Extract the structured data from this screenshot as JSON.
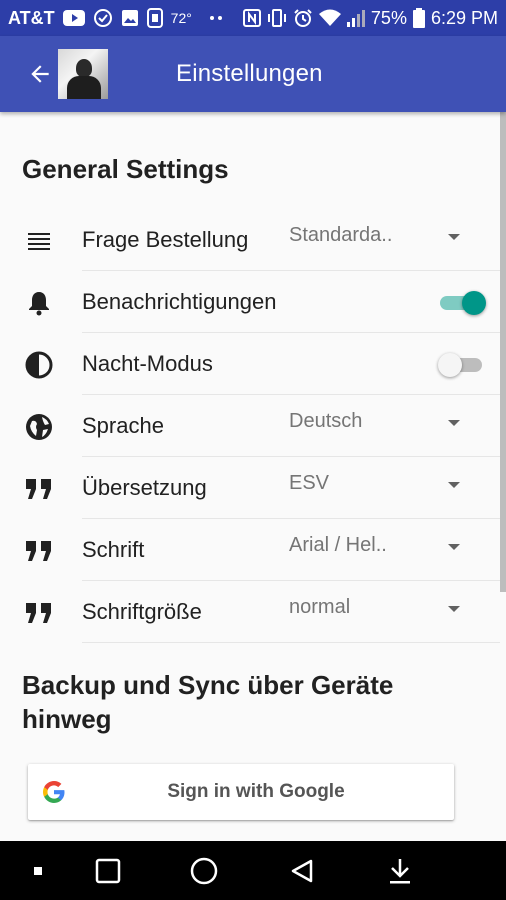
{
  "status_bar": {
    "carrier": "AT&T",
    "temperature": "72°",
    "battery_percent": "75%",
    "time": "6:29 PM",
    "icons_left": [
      "youtube-icon",
      "check-circle-icon",
      "image-icon",
      "app-icon",
      "weather-icon",
      "more-dots-icon"
    ],
    "icons_right": [
      "nfc-icon",
      "vibrate-icon",
      "alarm-icon",
      "wifi-icon",
      "signal-icon",
      "battery-icon"
    ]
  },
  "app_bar": {
    "title": "Einstellungen",
    "back_icon": "arrow-back-icon",
    "avatar": "profile-picture"
  },
  "general": {
    "title": "General Settings",
    "items": [
      {
        "icon": "list-icon",
        "label": "Frage Bestellung",
        "type": "dropdown",
        "value": "Standarda.."
      },
      {
        "icon": "bell-icon",
        "label": "Benachrichtigungen",
        "type": "toggle",
        "checked": true
      },
      {
        "icon": "contrast-icon",
        "label": "Nacht-Modus",
        "type": "toggle",
        "checked": false
      },
      {
        "icon": "globe-icon",
        "label": "Sprache",
        "type": "dropdown",
        "value": "Deutsch"
      },
      {
        "icon": "quote-icon",
        "label": "Übersetzung",
        "type": "dropdown",
        "value": "ESV"
      },
      {
        "icon": "quote-icon",
        "label": "Schrift",
        "type": "dropdown",
        "value": "Arial / Hel.."
      },
      {
        "icon": "quote-icon",
        "label": "Schriftgröße",
        "type": "dropdown",
        "value": "normal"
      }
    ]
  },
  "backup": {
    "title_line1": "Backup und Sync über Geräte",
    "title_line2": "hinweg",
    "google_button": "Sign in with Google"
  },
  "nav_bar": {
    "buttons": [
      "dot-icon",
      "recents-square-icon",
      "home-circle-icon",
      "back-triangle-icon",
      "download-arrow-icon"
    ]
  },
  "colors": {
    "status_bar": "#2d3ea8",
    "app_bar": "#3f51b5",
    "accent": "#009688",
    "background": "#fafafa"
  }
}
